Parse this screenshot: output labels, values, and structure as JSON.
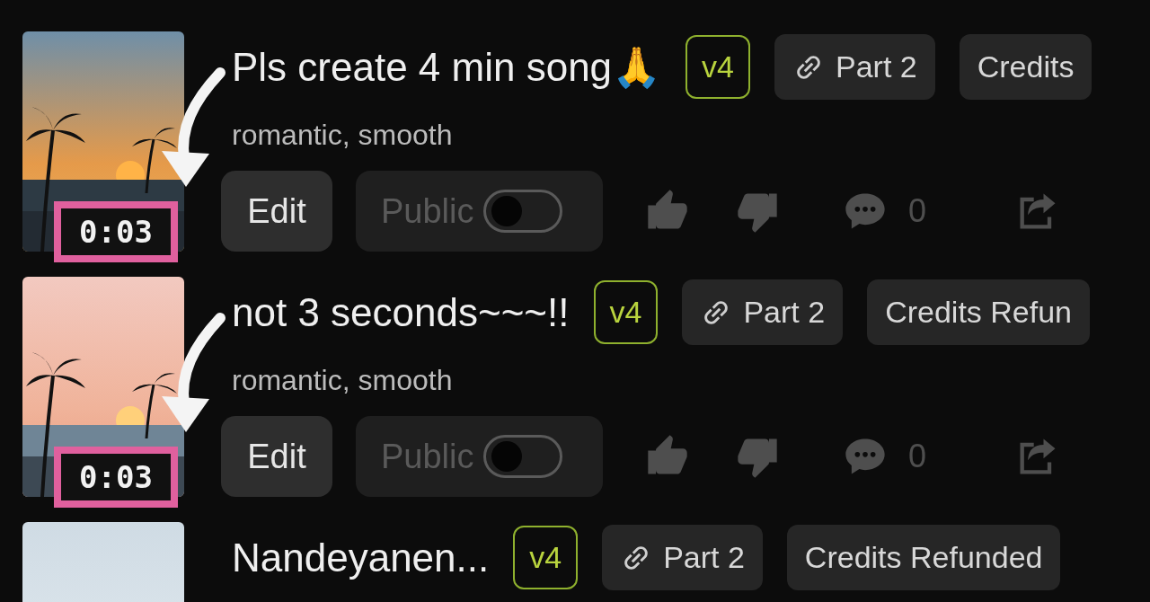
{
  "songs": [
    {
      "title": "Pls create 4 min song🙏",
      "version": "v4",
      "part_label": "Part 2",
      "status": "Credits",
      "tags": "romantic, smooth",
      "duration": "0:03",
      "annotated": true,
      "edit_label": "Edit",
      "public_label": "Public",
      "public": false,
      "public_disabled": true,
      "comment_count": "0"
    },
    {
      "title": "not 3 seconds~~~!!",
      "version": "v4",
      "part_label": "Part 2",
      "status": "Credits Refun",
      "tags": "romantic, smooth",
      "duration": "0:03",
      "annotated": true,
      "edit_label": "Edit",
      "public_label": "Public",
      "public": false,
      "public_disabled": true,
      "comment_count": "0"
    },
    {
      "title": "Nandeyanen...",
      "version": "v4",
      "part_label": "Part 2",
      "status": "Credits Refunded"
    }
  ]
}
